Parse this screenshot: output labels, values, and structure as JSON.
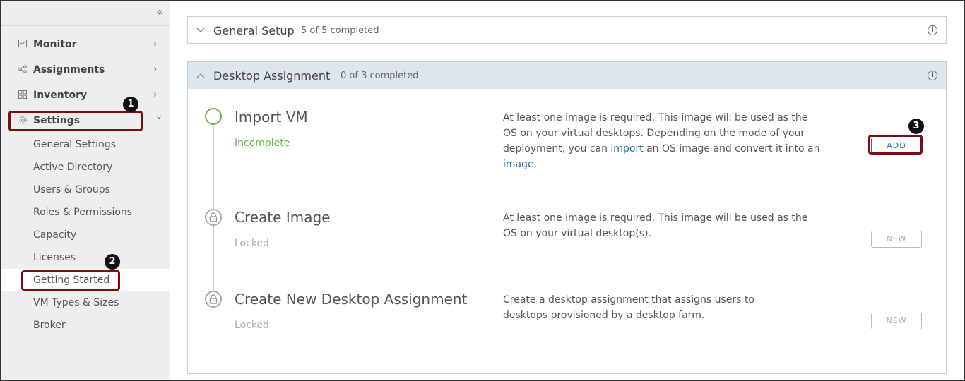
{
  "sidebar": {
    "collapse_icon": "double-chevron-left-icon",
    "top_items": [
      {
        "label": "Monitor",
        "icon": "monitor-icon"
      },
      {
        "label": "Assignments",
        "icon": "share-icon"
      },
      {
        "label": "Inventory",
        "icon": "grid-icon"
      },
      {
        "label": "Settings",
        "icon": "gear-icon"
      }
    ],
    "settings_items": [
      {
        "label": "General Settings"
      },
      {
        "label": "Active Directory"
      },
      {
        "label": "Users & Groups"
      },
      {
        "label": "Roles & Permissions"
      },
      {
        "label": "Capacity"
      },
      {
        "label": "Licenses"
      },
      {
        "label": "Getting Started"
      },
      {
        "label": "VM Types & Sizes"
      },
      {
        "label": "Broker"
      }
    ]
  },
  "general_setup": {
    "title": "General Setup",
    "count": "5 of 5 completed"
  },
  "desktop_assignment": {
    "title": "Desktop Assignment",
    "count": "0 of 3 completed",
    "steps": [
      {
        "title": "Import VM",
        "status": "Incomplete",
        "desc_part1": "At least one image is required. This image will be used as the OS on your virtual desktops. Depending on the mode of your deployment, you can ",
        "link1": "import",
        "desc_part2": " an OS image and convert it into an ",
        "link2": "image",
        "desc_part3": ".",
        "button": "ADD"
      },
      {
        "title": "Create Image",
        "status": "Locked",
        "desc": "At least one image is required. This image will be used as the OS on your virtual desktop(s).",
        "button": "NEW"
      },
      {
        "title": "Create New Desktop Assignment",
        "status": "Locked",
        "desc": "Create a desktop assignment that assigns users to desktops provisioned by a desktop farm.",
        "button": "NEW"
      }
    ]
  },
  "annotations": [
    "1",
    "2",
    "3"
  ],
  "colors": {
    "accent": "#1b6fa3",
    "success": "#6ab04c",
    "highlight": "#7a0e14",
    "section_header": "#dce6ec"
  }
}
